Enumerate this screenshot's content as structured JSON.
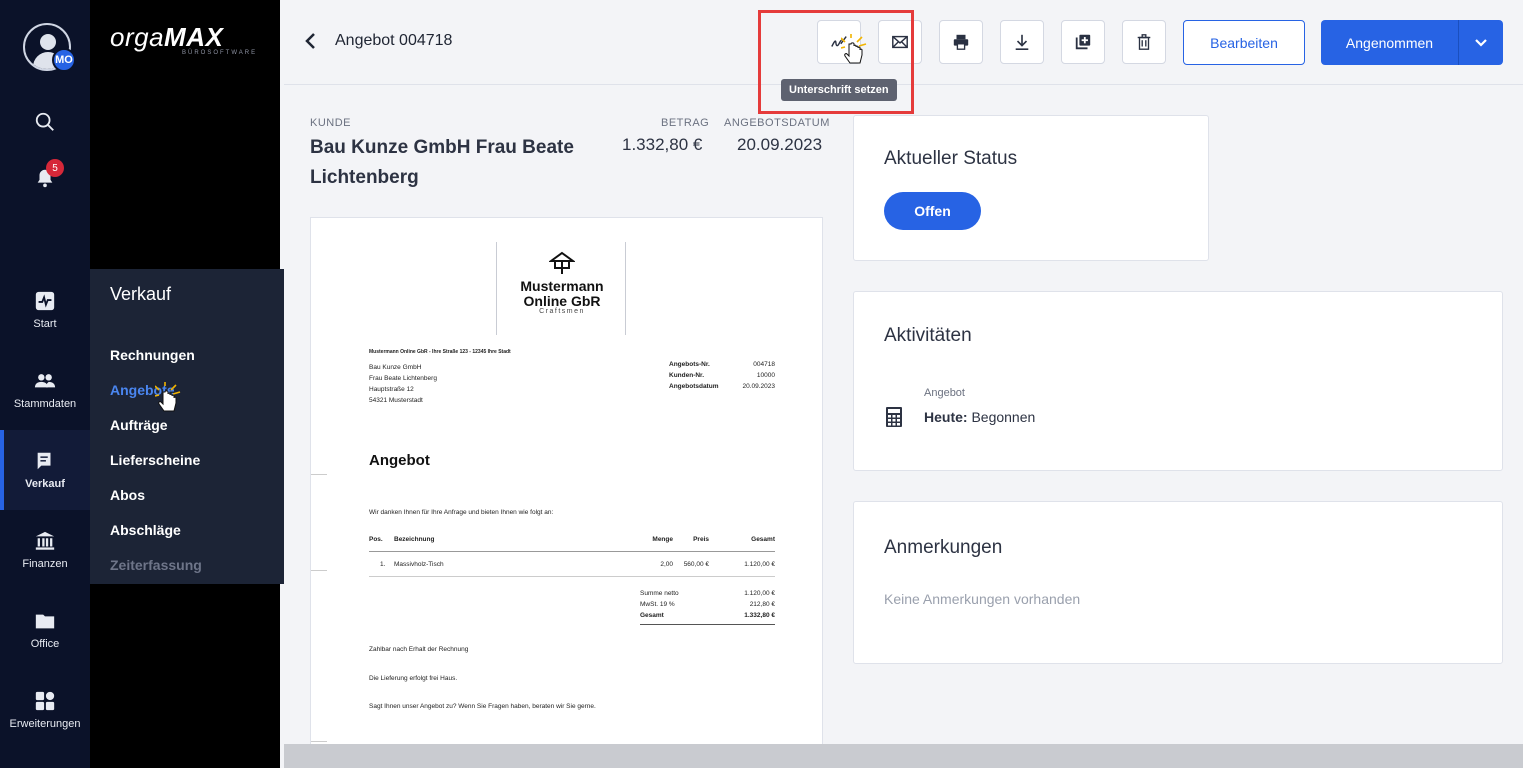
{
  "rail": {
    "avatar_initials": "MO",
    "notifications_count": "5",
    "items": [
      {
        "label": "Start",
        "icon": "activity-icon"
      },
      {
        "label": "Stammdaten",
        "icon": "people-icon"
      },
      {
        "label": "Verkauf",
        "icon": "sales-icon"
      },
      {
        "label": "Finanzen",
        "icon": "bank-icon"
      },
      {
        "label": "Office",
        "icon": "folder-icon"
      },
      {
        "label": "Erweiterungen",
        "icon": "extensions-icon"
      }
    ]
  },
  "brand": {
    "logo_light": "orga",
    "logo_bold": "MAX",
    "tagline": "BÜROSOFTWARE"
  },
  "submenu": {
    "title": "Verkauf",
    "items": [
      "Rechnungen",
      "Angebote",
      "Aufträge",
      "Lieferscheine",
      "Abos",
      "Abschläge",
      "Zeiterfassung"
    ]
  },
  "toolbar": {
    "title": "Angebot 004718",
    "tooltip": "Unterschrift setzen",
    "edit_label": "Bearbeiten",
    "accept_label": "Angenommen"
  },
  "summary": {
    "customer_label": "KUNDE",
    "customer_name": "Bau Kunze GmbH Frau Beate Lichtenberg",
    "amount_label": "BETRAG",
    "amount": "1.332,80 €",
    "date_label": "ANGEBOTSDATUM",
    "date": "20.09.2023"
  },
  "document": {
    "company_line1": "Mustermann",
    "company_line2": "Online GbR",
    "company_sub": "Craftsmen",
    "sender_line": "Mustermann Online GbR - Ihre Straße 123 - 12345 Ihre Stadt",
    "recipient": [
      "Bau Kunze GmbH",
      "Frau Beate Lichtenberg",
      "Hauptstraße 12",
      "54321 Musterstadt"
    ],
    "meta": [
      {
        "key": "Angebots-Nr.",
        "value": "004718"
      },
      {
        "key": "Kunden-Nr.",
        "value": "10000"
      },
      {
        "key": "Angebotsdatum",
        "value": "20.09.2023"
      }
    ],
    "heading": "Angebot",
    "intro": "Wir danken Ihnen für Ihre Anfrage und bieten Ihnen wie folgt an:",
    "table_headers": {
      "pos": "Pos.",
      "desc": "Bezeichnung",
      "qty": "Menge",
      "price": "Preis",
      "total": "Gesamt"
    },
    "rows": [
      {
        "pos": "1.",
        "desc": "Massivholz-Tisch",
        "qty": "2,00",
        "price": "560,00 €",
        "total": "1.120,00 €"
      }
    ],
    "totals": [
      {
        "key": "Summe netto",
        "value": "1.120,00 €"
      },
      {
        "key": "MwSt. 19 %",
        "value": "212,80 €"
      },
      {
        "key": "Gesamt",
        "value": "1.332,80 €"
      }
    ],
    "footer": [
      "Zahlbar nach Erhalt der Rechnung",
      "Die Lieferung erfolgt frei Haus.",
      "Sagt Ihnen unser Angebot zu? Wenn Sie Fragen haben, beraten wir Sie gerne."
    ]
  },
  "status_card": {
    "title": "Aktueller Status",
    "status": "Offen"
  },
  "activities_card": {
    "title": "Aktivitäten",
    "type": "Angebot",
    "when": "Heute:",
    "what": "Begonnen"
  },
  "notes_card": {
    "title": "Anmerkungen",
    "empty": "Keine Anmerkungen vorhanden"
  },
  "colors": {
    "accent": "#2763e4",
    "rail": "#0b1229",
    "highlight": "#e53b3b"
  }
}
